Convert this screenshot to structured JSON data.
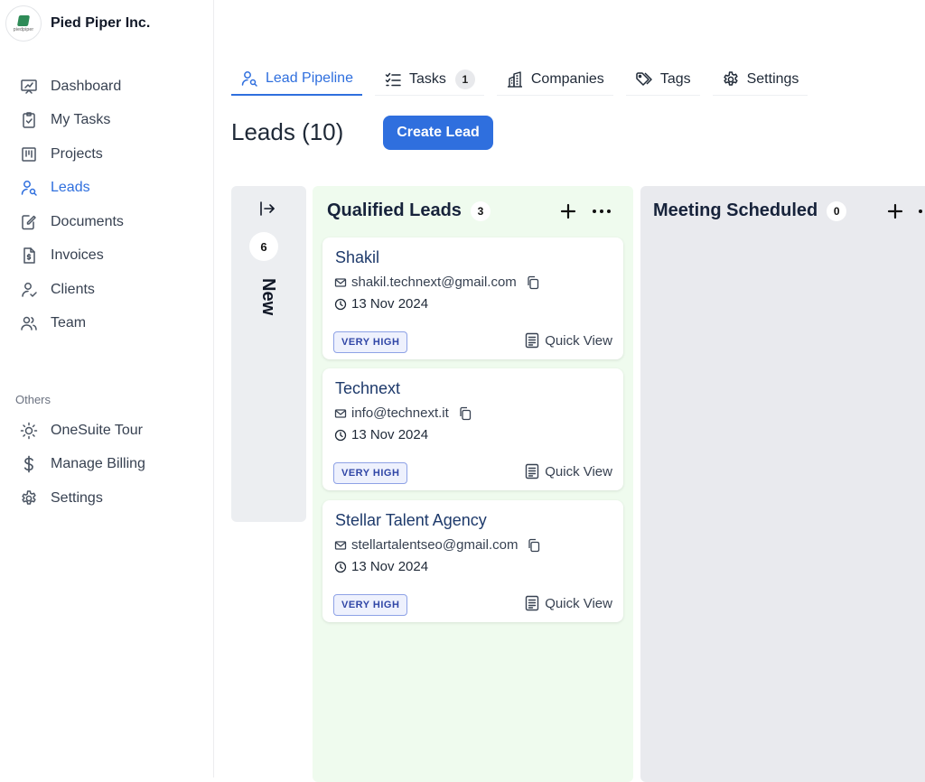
{
  "brand": {
    "name": "Pied Piper Inc.",
    "logo_text": "piedpiper"
  },
  "sidebar": {
    "items": [
      {
        "label": "Dashboard",
        "icon": "presentation-icon",
        "active": false
      },
      {
        "label": "My Tasks",
        "icon": "clipboard-check-icon",
        "active": false
      },
      {
        "label": "Projects",
        "icon": "kanban-icon",
        "active": false
      },
      {
        "label": "Leads",
        "icon": "user-search-icon",
        "active": true
      },
      {
        "label": "Documents",
        "icon": "document-edit-icon",
        "active": false
      },
      {
        "label": "Invoices",
        "icon": "invoice-icon",
        "active": false
      },
      {
        "label": "Clients",
        "icon": "user-check-icon",
        "active": false
      },
      {
        "label": "Team",
        "icon": "users-icon",
        "active": false
      }
    ],
    "section_label": "Others",
    "others": [
      {
        "label": "OneSuite Tour",
        "icon": "sun-icon"
      },
      {
        "label": "Manage Billing",
        "icon": "dollar-icon"
      },
      {
        "label": "Settings",
        "icon": "gear-icon"
      }
    ]
  },
  "tabs": [
    {
      "label": "Lead Pipeline",
      "icon": "user-search-icon",
      "active": true
    },
    {
      "label": "Tasks",
      "icon": "checklist-icon",
      "count": "1"
    },
    {
      "label": "Companies",
      "icon": "building-icon"
    },
    {
      "label": "Tags",
      "icon": "tags-icon"
    },
    {
      "label": "Settings",
      "icon": "gear-icon"
    }
  ],
  "page": {
    "title": "Leads (10)",
    "create_button": "Create Lead"
  },
  "board": {
    "collapsed": {
      "name": "New",
      "count": "6"
    },
    "columns": [
      {
        "title": "Qualified Leads",
        "count": "3",
        "color": "#effbee",
        "cards": [
          {
            "name": "Shakil",
            "email": "shakil.technext@gmail.com",
            "date": "13 Nov 2024",
            "priority": "VERY HIGH",
            "quick_view": "Quick View"
          },
          {
            "name": "Technext",
            "email": "info@technext.it",
            "date": "13 Nov 2024",
            "priority": "VERY HIGH",
            "quick_view": "Quick View"
          },
          {
            "name": "Stellar Talent Agency",
            "email": "stellartalentseo@gmail.com",
            "date": "13 Nov 2024",
            "priority": "VERY HIGH",
            "quick_view": "Quick View"
          }
        ]
      },
      {
        "title": "Meeting Scheduled",
        "count": "0",
        "color": "#e9eaee",
        "cards": []
      }
    ]
  },
  "colors": {
    "accent": "#2f6fde",
    "priority_text": "#3046a6",
    "priority_bg": "#eef1fd"
  }
}
